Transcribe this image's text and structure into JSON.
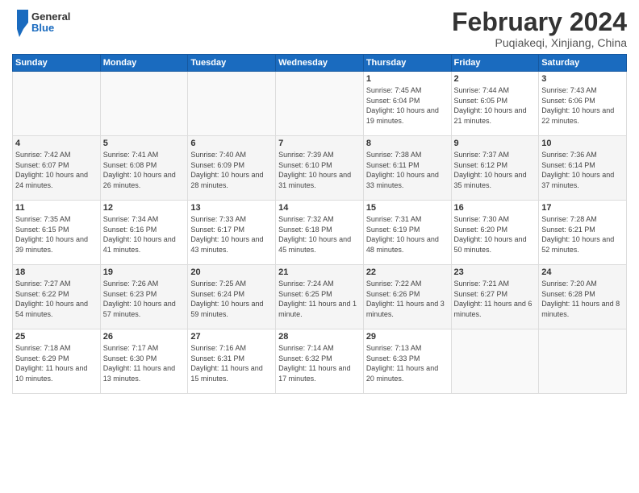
{
  "logo": {
    "text_general": "General",
    "text_blue": "Blue"
  },
  "header": {
    "month_title": "February 2024",
    "location": "Puqiakeqi, Xinjiang, China"
  },
  "weekdays": [
    "Sunday",
    "Monday",
    "Tuesday",
    "Wednesday",
    "Thursday",
    "Friday",
    "Saturday"
  ],
  "weeks": [
    [
      {
        "day": "",
        "info": ""
      },
      {
        "day": "",
        "info": ""
      },
      {
        "day": "",
        "info": ""
      },
      {
        "day": "",
        "info": ""
      },
      {
        "day": "1",
        "info": "Sunrise: 7:45 AM\nSunset: 6:04 PM\nDaylight: 10 hours and 19 minutes."
      },
      {
        "day": "2",
        "info": "Sunrise: 7:44 AM\nSunset: 6:05 PM\nDaylight: 10 hours and 21 minutes."
      },
      {
        "day": "3",
        "info": "Sunrise: 7:43 AM\nSunset: 6:06 PM\nDaylight: 10 hours and 22 minutes."
      }
    ],
    [
      {
        "day": "4",
        "info": "Sunrise: 7:42 AM\nSunset: 6:07 PM\nDaylight: 10 hours and 24 minutes."
      },
      {
        "day": "5",
        "info": "Sunrise: 7:41 AM\nSunset: 6:08 PM\nDaylight: 10 hours and 26 minutes."
      },
      {
        "day": "6",
        "info": "Sunrise: 7:40 AM\nSunset: 6:09 PM\nDaylight: 10 hours and 28 minutes."
      },
      {
        "day": "7",
        "info": "Sunrise: 7:39 AM\nSunset: 6:10 PM\nDaylight: 10 hours and 31 minutes."
      },
      {
        "day": "8",
        "info": "Sunrise: 7:38 AM\nSunset: 6:11 PM\nDaylight: 10 hours and 33 minutes."
      },
      {
        "day": "9",
        "info": "Sunrise: 7:37 AM\nSunset: 6:12 PM\nDaylight: 10 hours and 35 minutes."
      },
      {
        "day": "10",
        "info": "Sunrise: 7:36 AM\nSunset: 6:14 PM\nDaylight: 10 hours and 37 minutes."
      }
    ],
    [
      {
        "day": "11",
        "info": "Sunrise: 7:35 AM\nSunset: 6:15 PM\nDaylight: 10 hours and 39 minutes."
      },
      {
        "day": "12",
        "info": "Sunrise: 7:34 AM\nSunset: 6:16 PM\nDaylight: 10 hours and 41 minutes."
      },
      {
        "day": "13",
        "info": "Sunrise: 7:33 AM\nSunset: 6:17 PM\nDaylight: 10 hours and 43 minutes."
      },
      {
        "day": "14",
        "info": "Sunrise: 7:32 AM\nSunset: 6:18 PM\nDaylight: 10 hours and 45 minutes."
      },
      {
        "day": "15",
        "info": "Sunrise: 7:31 AM\nSunset: 6:19 PM\nDaylight: 10 hours and 48 minutes."
      },
      {
        "day": "16",
        "info": "Sunrise: 7:30 AM\nSunset: 6:20 PM\nDaylight: 10 hours and 50 minutes."
      },
      {
        "day": "17",
        "info": "Sunrise: 7:28 AM\nSunset: 6:21 PM\nDaylight: 10 hours and 52 minutes."
      }
    ],
    [
      {
        "day": "18",
        "info": "Sunrise: 7:27 AM\nSunset: 6:22 PM\nDaylight: 10 hours and 54 minutes."
      },
      {
        "day": "19",
        "info": "Sunrise: 7:26 AM\nSunset: 6:23 PM\nDaylight: 10 hours and 57 minutes."
      },
      {
        "day": "20",
        "info": "Sunrise: 7:25 AM\nSunset: 6:24 PM\nDaylight: 10 hours and 59 minutes."
      },
      {
        "day": "21",
        "info": "Sunrise: 7:24 AM\nSunset: 6:25 PM\nDaylight: 11 hours and 1 minute."
      },
      {
        "day": "22",
        "info": "Sunrise: 7:22 AM\nSunset: 6:26 PM\nDaylight: 11 hours and 3 minutes."
      },
      {
        "day": "23",
        "info": "Sunrise: 7:21 AM\nSunset: 6:27 PM\nDaylight: 11 hours and 6 minutes."
      },
      {
        "day": "24",
        "info": "Sunrise: 7:20 AM\nSunset: 6:28 PM\nDaylight: 11 hours and 8 minutes."
      }
    ],
    [
      {
        "day": "25",
        "info": "Sunrise: 7:18 AM\nSunset: 6:29 PM\nDaylight: 11 hours and 10 minutes."
      },
      {
        "day": "26",
        "info": "Sunrise: 7:17 AM\nSunset: 6:30 PM\nDaylight: 11 hours and 13 minutes."
      },
      {
        "day": "27",
        "info": "Sunrise: 7:16 AM\nSunset: 6:31 PM\nDaylight: 11 hours and 15 minutes."
      },
      {
        "day": "28",
        "info": "Sunrise: 7:14 AM\nSunset: 6:32 PM\nDaylight: 11 hours and 17 minutes."
      },
      {
        "day": "29",
        "info": "Sunrise: 7:13 AM\nSunset: 6:33 PM\nDaylight: 11 hours and 20 minutes."
      },
      {
        "day": "",
        "info": ""
      },
      {
        "day": "",
        "info": ""
      }
    ]
  ]
}
